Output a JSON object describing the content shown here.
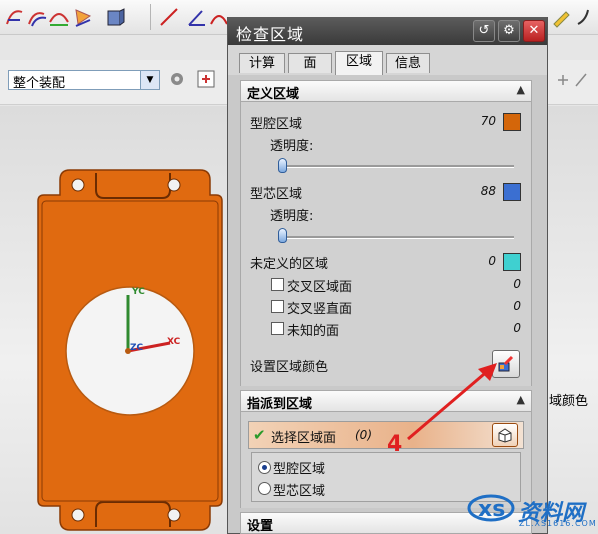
{
  "toolbar": {
    "assembly_select_value": "整个装配"
  },
  "dialog": {
    "title": "检查区域",
    "tabs": [
      {
        "label": "计算",
        "active": false
      },
      {
        "label": "面",
        "active": false
      },
      {
        "label": "区域",
        "active": true
      },
      {
        "label": "信息",
        "active": false
      }
    ],
    "define_region": {
      "header": "定义区域",
      "cavity": {
        "label": "型腔区域",
        "count": "70",
        "color": "#d4660a",
        "transparency_label": "透明度:"
      },
      "core": {
        "label": "型芯区域",
        "count": "88",
        "color": "#3b6fd1",
        "transparency_label": "透明度:"
      },
      "undefined": {
        "label": "未定义的区域",
        "count": "0",
        "color": "#3fd0d0"
      },
      "sub_items": [
        {
          "label": "交叉区域面",
          "count": "0"
        },
        {
          "label": "交叉竖直面",
          "count": "0"
        },
        {
          "label": "未知的面",
          "count": "0"
        }
      ],
      "set_color_label": "设置区域颜色"
    },
    "assign": {
      "header": "指派到区域",
      "select_face_label": "选择区域面",
      "select_face_count": "(0)",
      "options": [
        {
          "label": "型腔区域",
          "selected": true
        },
        {
          "label": "型芯区域",
          "selected": false
        }
      ]
    },
    "settings_header": "设置"
  },
  "viewport": {
    "axis_yc": "YC",
    "axis_xc": "XC",
    "axis_zc": "ZC",
    "side_label": "域颜色",
    "part_color": "#e06a10"
  },
  "annotation": {
    "number": "4",
    "color": "#e02020"
  },
  "watermark": {
    "brand": "资料网",
    "url": "ZL.XS1616.COM"
  }
}
